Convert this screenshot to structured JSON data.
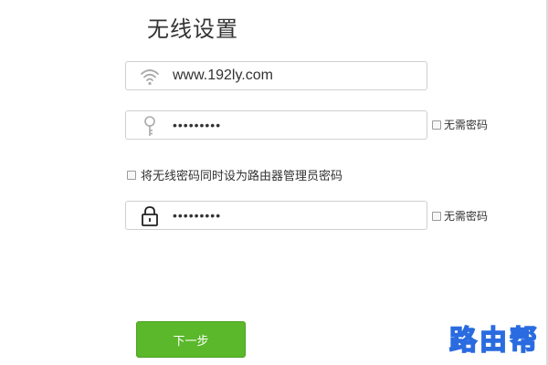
{
  "page": {
    "title": "无线设置"
  },
  "ssid_field": {
    "value": "www.192ly.com",
    "icon": "wifi-icon"
  },
  "wifi_password_field": {
    "value": "•••••••••",
    "icon": "key-icon",
    "no_password_label": "无需密码"
  },
  "same_as_admin": {
    "label": "将无线密码同时设为路由器管理员密码",
    "checked": false
  },
  "admin_password_field": {
    "value": "•••••••••",
    "icon": "lock-icon",
    "no_password_label": "无需密码"
  },
  "actions": {
    "next_label": "下一步"
  },
  "watermark": {
    "text": "路由帮"
  },
  "colors": {
    "accent": "#5ab82a",
    "watermark": "#2a6be0",
    "border": "#cfcfcf"
  }
}
